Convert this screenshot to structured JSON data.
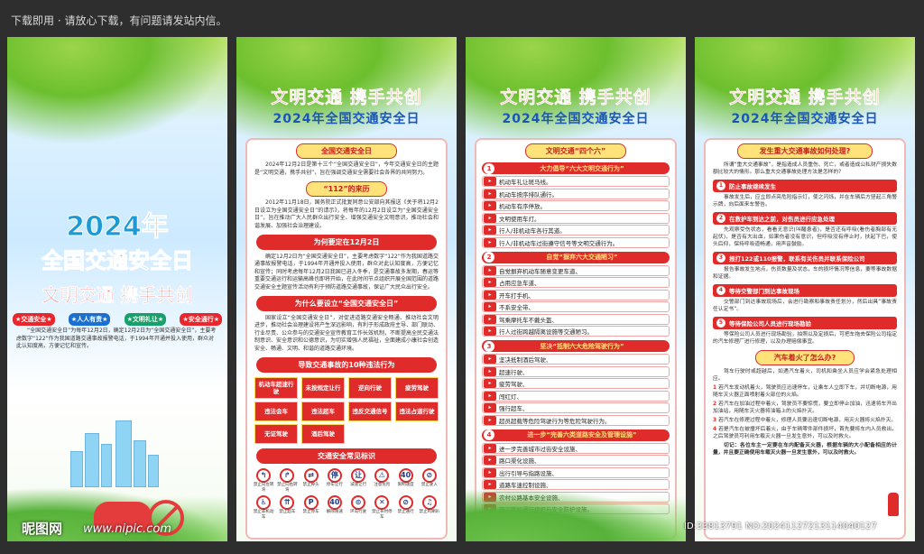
{
  "topbar": {
    "notice": "下载即用 · 请放心下载，有问题请发站内信。"
  },
  "panel1": {
    "year": "2024年",
    "headline": "全国交通安全日",
    "slogan": "文明交通 携手共创",
    "tags": [
      "★交通安全★",
      "★人人有责★",
      "★文明礼让★",
      "★安全通行★"
    ],
    "tag_colors": [
      "#e8262b",
      "#1b6fd0",
      "#18a06a",
      "#e8262b"
    ],
    "intro": "“全国交通安全日”为每年12月2日，确定12月2日为“全国交通安全日”，主要考虑数字“122”作为我国道路交通事故报警电话，于1994年开通并投入使用，群众对此认知度高，方便记忆和宣传。",
    "watermark": "昵图网",
    "watermark_url": "www.nipic.com"
  },
  "header": {
    "title1": "文明交通 携手共创",
    "title2": "2024年全国交通安全日"
  },
  "panel2": {
    "badge": "全国交通安全日",
    "p1": "2024年12月2日是第十三个“全国交通安全日”，今年交通安全日的主题是“文明交通，携手共创”，旨在强调交通安全需要社会各界的共同努力。",
    "h1": "“112”的来历",
    "p2": "2012年11月18日，国务院正式批复同意公安部向其报送《关于将12月2日设立为全国交通安全日”的请示》，将每年的12月2日设立为“全国交通安全日”，旨在推动广大人民群众出行安全、增强交通安全文明意识，推动社会和谐发展、加强社会治理建设。",
    "h2": "为何要定在12月2日",
    "p3": "确定12月2日为“全国交通安全日”，主要考虑数字“122”作为我国道路交通事故报警电话，于1994年开通并投入使用，群众对此认知度高，方便记忆和宣传；同时考虑每年12月2日我国已进入冬季，是交通事故多发期，春运等重要交通运行和运输高峰也即将开始，在此时间节点组织开展全国范围的道路交通安全主题宣传活动有利于预防道路交通事故，保证广大民众出行安全。",
    "h3": "为什么要设立“全国交通安全日”",
    "p4": "国家设立“全国交通安全日”，对促进道路交通安全畅通、推动社会文明进步，推动社会治理建设将产生深远影响，有利于形成政府主导、部门联动、行业尽责、公众参与的交通安全宣传教育工作长效机制，不断提高全民交通法制意识、安全意识和公德意识，为切实增强人民福祉，全面建成小康社会创造安全、畅通、文明、和谐的道路交通环境。",
    "h4": "导致交通事故的10种违法行为",
    "violations": [
      "机动车超速行驶",
      "未按规定让行",
      "逆向行驶",
      "疲劳驾驶",
      "违法会车",
      "违法超车",
      "违反交通信号",
      "违法占道行驶",
      "无证驾驶",
      "酒后驾驶"
    ],
    "h5": "交通安全常见标识",
    "signs": [
      {
        "icon": "↰",
        "label": "禁止向左转弯"
      },
      {
        "icon": "↱",
        "label": "禁止向右转弯"
      },
      {
        "icon": "⇄",
        "label": "禁止掉头"
      },
      {
        "icon": "停",
        "label": "停车让行"
      },
      {
        "icon": "让",
        "label": "减速让行"
      },
      {
        "icon": "⚠",
        "label": "注意危险"
      },
      {
        "icon": "40",
        "label": "限制速度"
      },
      {
        "icon": "⊘",
        "label": "禁止驶入"
      },
      {
        "icon": "♿",
        "label": "禁止非机动车"
      },
      {
        "icon": "⇈",
        "label": "禁止超车"
      },
      {
        "icon": "P",
        "label": "禁止停车"
      },
      {
        "icon": "40",
        "label": "解除限速"
      },
      {
        "icon": "⊙",
        "label": "环岛行驶"
      },
      {
        "icon": "✕",
        "label": "禁止长时停车"
      },
      {
        "icon": "⊘",
        "label": "禁止通行"
      },
      {
        "icon": "♫",
        "label": "禁止鸣喇叭"
      }
    ]
  },
  "panel3": {
    "badge": "文明交通“四个六”",
    "blocks": [
      {
        "num": "1",
        "title": "大力倡导“六大文明交通行为”",
        "items": [
          "机动车礼让斑马线。",
          "机动车按序排队通行。",
          "机动车有序停放。",
          "文明使用车灯。",
          "行人/非机动车各行其道。",
          "行人/非机动车过街遵守信号等文明交通行为。"
        ]
      },
      {
        "num": "2",
        "title": "自觉“摒弃六大交通陋习”",
        "items": [
          "自觉摒弃机动车随意变更车道、",
          "占用应急车道、",
          "开车打手机、",
          "不系安全带、",
          "驾乘摩托车不戴头盔、",
          "行人过街跨越隔离设施等交通陋习。"
        ]
      },
      {
        "num": "3",
        "title": "坚决“抵制六大危险驾驶行为”",
        "items": [
          "坚决抵制酒后驾驶、",
          "超速行驶、",
          "疲劳驾驶、",
          "闯红灯、",
          "强行超车、",
          "超员超载等危险驾驶行为等危险驾驶行为。"
        ]
      },
      {
        "num": "4",
        "title": "进一步“完善六类道路安全及管理设施”",
        "items": [
          "进一步完善城市过街安全设施、",
          "路口渠化设施、",
          "出行引导与指路设施、",
          "道路车速控制设施、",
          "农村公路基本安全设施、",
          "施工路段通行组织与安全防护设施。"
        ]
      }
    ]
  },
  "panel4": {
    "badge": "发生重大交通事故如何处理?",
    "intro": "所谓“重大交通事故”，是指造成人员重伤、死亡，或者造成公私财产损失数额比较大的情形。那么重大交通事故处理方法是怎样的?",
    "steps": [
      {
        "num": "1",
        "title": "防止事故继续发生",
        "text": "事故发生后，应立即点亮危险指示灯，使之闪烁，并在车辆后方竖起三角警示牌，向后面来车警告。"
      },
      {
        "num": "2",
        "title": "在救护车到达之前，对伤员进行应急处理",
        "text": "先观察受伤状态，看看无意识(叫醒患者)，是否还有呼吸(看伤者胸部有无起伏)，是否有大出血，如果伤者没有意识，但呼吸没有停止时，扶起下巴，使头后仰，保持呼吸道畅通，用声音鼓励。"
      },
      {
        "num": "3",
        "title": "报打122或110报警，联系有关伤员并联系保险公司",
        "text": "报告事故发生地点，伤员数量及状态，车的损坏情况等信息，要等事故数据和证据。"
      },
      {
        "num": "4",
        "title": "等待交警部门到达事故现场",
        "text": "交警部门到达事故现场后，会进行勘察和事故责任划分，然后出具“事故责任认定书”。"
      },
      {
        "num": "5",
        "title": "等待保险公司人员进行现场勘验",
        "text": "等保险公司人员进行现场勘验，拍照以及定损后，可把车拖去保险公司指定的汽车修理厂进行修理，以及办理赔偿事宜。"
      }
    ],
    "fire_badge": "汽车着火了怎么办?",
    "fire_intro": "驾车行驶时或超越后，如遇汽车着火，司机和乘坐人员应学会紧急处理相应。",
    "fire_items": [
      {
        "num": "1",
        "text": "若汽车发动机着火，驾驶员应迅速停车，让乘车人立即下车，并切断电源，用随车灭火器正面喷射着火部位的火焰。"
      },
      {
        "num": "2",
        "text": "若汽车在加油过程中着火，驾驶员不要惊慌，要立即停止加油，迅速将车开出加油站，用随车灭火器将油箱上的火焰扑灭。"
      },
      {
        "num": "3",
        "text": "若汽车在修理过程中着火，修理人员要迅速切断电源，用灭火器将火焰扑灭。"
      },
      {
        "num": "4",
        "text": "若是汽车在被撞坏后着火，由于车辆零件部件损坏，首先要将车内人员救出，之后驾驶员可利用车载灭火器一旦发生意外，可以及时救火。"
      }
    ],
    "footer": "切记：各位车主一定要在车内配备灭火器，根据车辆的大小配备相应的计量，并且要正确使用车载灭火器一旦发生意外，可以及时救火。",
    "id_text": "ID:33813791 NO:20241127213114040127"
  }
}
